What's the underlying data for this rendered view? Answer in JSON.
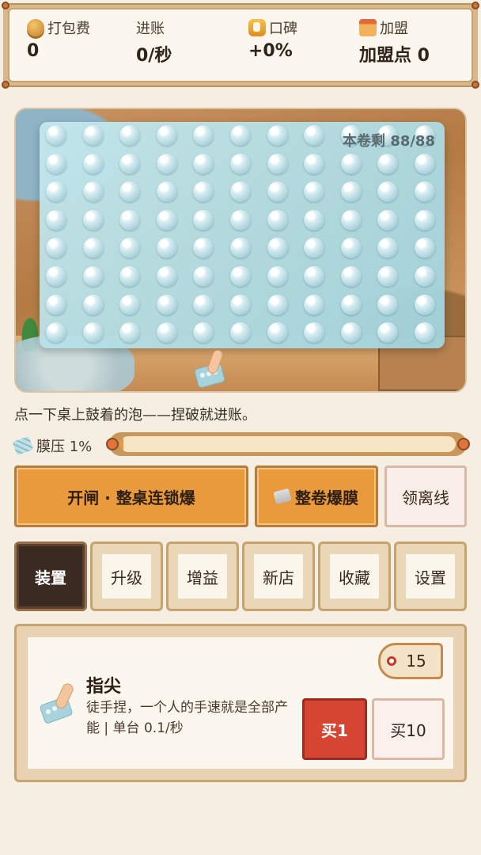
{
  "stats": [
    {
      "icon": "coin-stack-icon",
      "label": "打包费",
      "value": "0"
    },
    {
      "icon": "",
      "label": "进账",
      "value": "0/秒"
    },
    {
      "icon": "thumbs-up-icon",
      "label": "口碑",
      "value": "+0%"
    },
    {
      "icon": "shop-icon",
      "label": "加盟",
      "value": "加盟点 0"
    }
  ],
  "scene": {
    "remaining": "本卷剩 88/88",
    "rows": 8,
    "cols": 11
  },
  "hint": "点一下桌上鼓着的泡——捏破就进账。",
  "pressure": {
    "label": "膜压 1%",
    "value_fraction": 0.01
  },
  "actions": {
    "chain_label": "开闸 · 整桌连锁爆",
    "roll_label": "整卷爆膜",
    "offline_label": "领离线"
  },
  "tabs": [
    "装置",
    "升级",
    "增益",
    "新店",
    "收藏",
    "设置"
  ],
  "active_tab": 0,
  "item": {
    "name": "指尖",
    "description": "徒手捏，一个人的手速就是全部产能 | 单台 0.1/秒",
    "count": "15",
    "buy1_label": "买1",
    "buy10_label": "买10"
  },
  "colors": {
    "accent_orange": "#e89a3c",
    "buy_red": "#d64532",
    "active_tab": "#3a2a22",
    "background": "#f4eee3"
  }
}
